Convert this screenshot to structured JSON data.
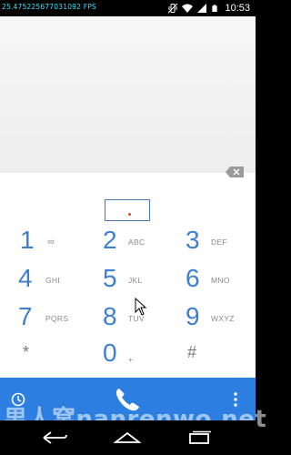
{
  "status_bar": {
    "left_text": "25.4752256770310",
    "left_text_tail": "92 FPS",
    "time": "10:53",
    "icons": [
      "vibrate-icon",
      "wifi-icon",
      "signal-icon",
      "battery-icon"
    ]
  },
  "dialpad": {
    "digits_value": "",
    "keys": [
      {
        "digit": "1",
        "letters": "∞"
      },
      {
        "digit": "2",
        "letters": "ABC"
      },
      {
        "digit": "3",
        "letters": "DEF"
      },
      {
        "digit": "4",
        "letters": "GHI"
      },
      {
        "digit": "5",
        "letters": "JKL"
      },
      {
        "digit": "6",
        "letters": "MNO"
      },
      {
        "digit": "7",
        "letters": "PQRS"
      },
      {
        "digit": "8",
        "letters": "TUV"
      },
      {
        "digit": "9",
        "letters": "WXYZ"
      },
      {
        "digit": "*",
        "letters": ""
      },
      {
        "digit": "0",
        "letters": "+"
      },
      {
        "digit": "#",
        "letters": ""
      }
    ]
  },
  "call_bar": {
    "color": "#2c7ee0",
    "icons": [
      "call-history-icon",
      "phone-icon",
      "overflow-menu-icon"
    ]
  },
  "watermark": {
    "text": "男人窝nanrenwo.net"
  },
  "nav_bar": {
    "icons": [
      "back-icon",
      "home-icon",
      "recents-icon"
    ]
  },
  "colors": {
    "accent": "#3d7fd0",
    "call_bar": "#2c7ee0",
    "cursor_dot": "#e24a12"
  }
}
